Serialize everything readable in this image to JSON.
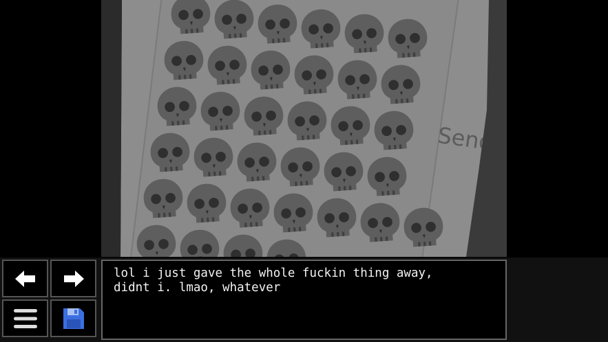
{
  "scene": {
    "description_icon": "skull-emoji-phone-icon",
    "send_label": "Send"
  },
  "controls": {
    "back_icon": "arrow-left-icon",
    "forward_icon": "arrow-right-icon",
    "menu_icon": "hamburger-menu-icon",
    "save_icon": "floppy-disk-icon"
  },
  "dialogue": {
    "text": "lol i just gave the whole fuckin thing away,\ndidnt i. lmao, whatever"
  },
  "colors": {
    "background": "#000000",
    "screen_gray": "#8a8a8a",
    "skull": "#5e5e5e",
    "save_blue": "#3b6fe0"
  }
}
